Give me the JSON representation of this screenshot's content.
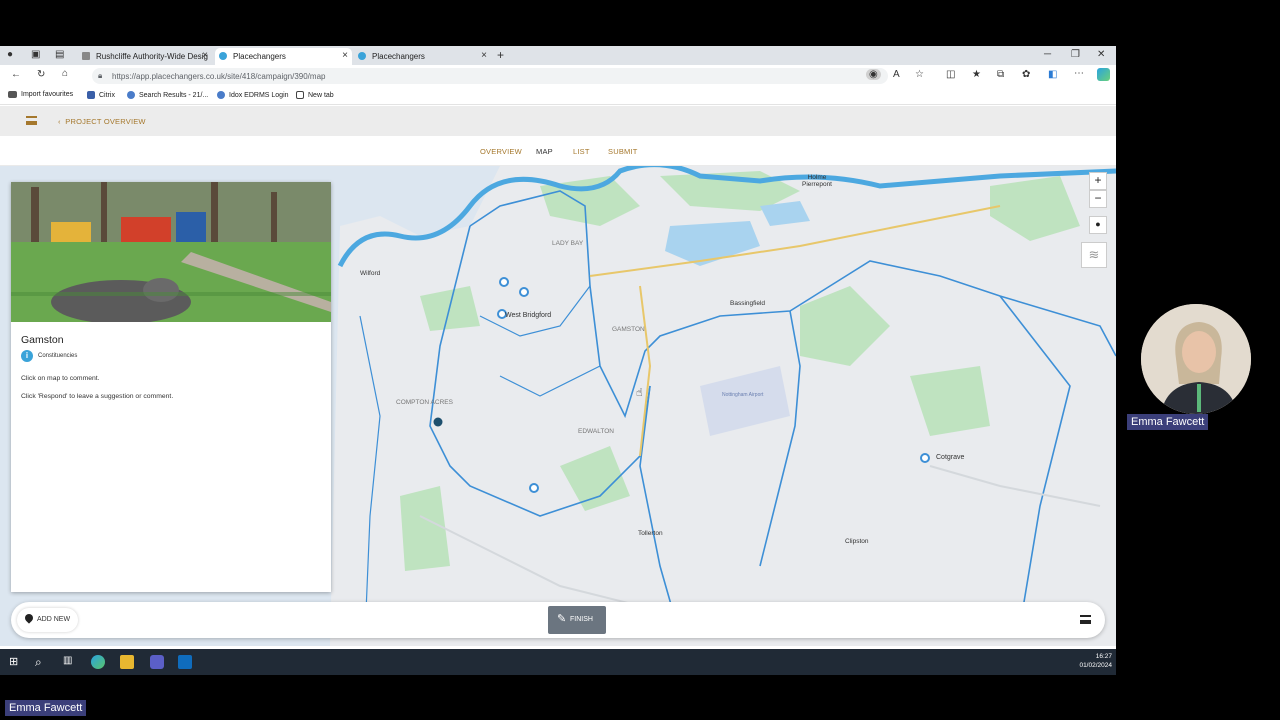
{
  "browser": {
    "tabs": [
      {
        "label": "Rushcliffe Authority-Wide Desig",
        "active": false
      },
      {
        "label": "Placechangers",
        "active": true
      },
      {
        "label": "Placechangers",
        "active": false
      }
    ],
    "new_tab": "+",
    "url": "https://app.placechangers.co.uk/site/418/campaign/390/map",
    "url_host": "app.placechangers.co.uk",
    "bookmarks": [
      "Import favourites",
      "Citrix",
      "Search Results - 21/...",
      "Idox EDRMS Login",
      "New tab"
    ]
  },
  "app": {
    "back_label": "PROJECT OVERVIEW",
    "nav": [
      "OVERVIEW",
      "MAP",
      "LIST",
      "SUBMIT"
    ],
    "active_nav": "MAP",
    "accent": "#a5782d"
  },
  "panel": {
    "title": "Gamston",
    "category": "Constituencies",
    "line1": "Click on map to comment.",
    "line2": "Click 'Respond' to leave a suggestion or comment."
  },
  "map_labels": {
    "holme_pierrepont": "Holme Pierrepont",
    "wilford": "Wilford",
    "west_bridgford": "West Bridgford",
    "bassingfield": "Bassingfield",
    "gamston": "GAMSTON",
    "lady_bay": "LADY BAY",
    "compton_acres": "COMPTON ACRES",
    "edwalton": "EDWALTON",
    "cotgrave": "Cotgrave",
    "tollerton": "Tollerton",
    "clipston": "Clipston",
    "nottingham_airport": "Nottingham Airport"
  },
  "toolbar": {
    "add_new": "ADD NEW",
    "finish": "FINISH"
  },
  "taskbar": {
    "time": "16:27",
    "date": "01/02/2024"
  },
  "call": {
    "participant": "Emma Fawcett",
    "presenter": "Emma Fawcett"
  }
}
